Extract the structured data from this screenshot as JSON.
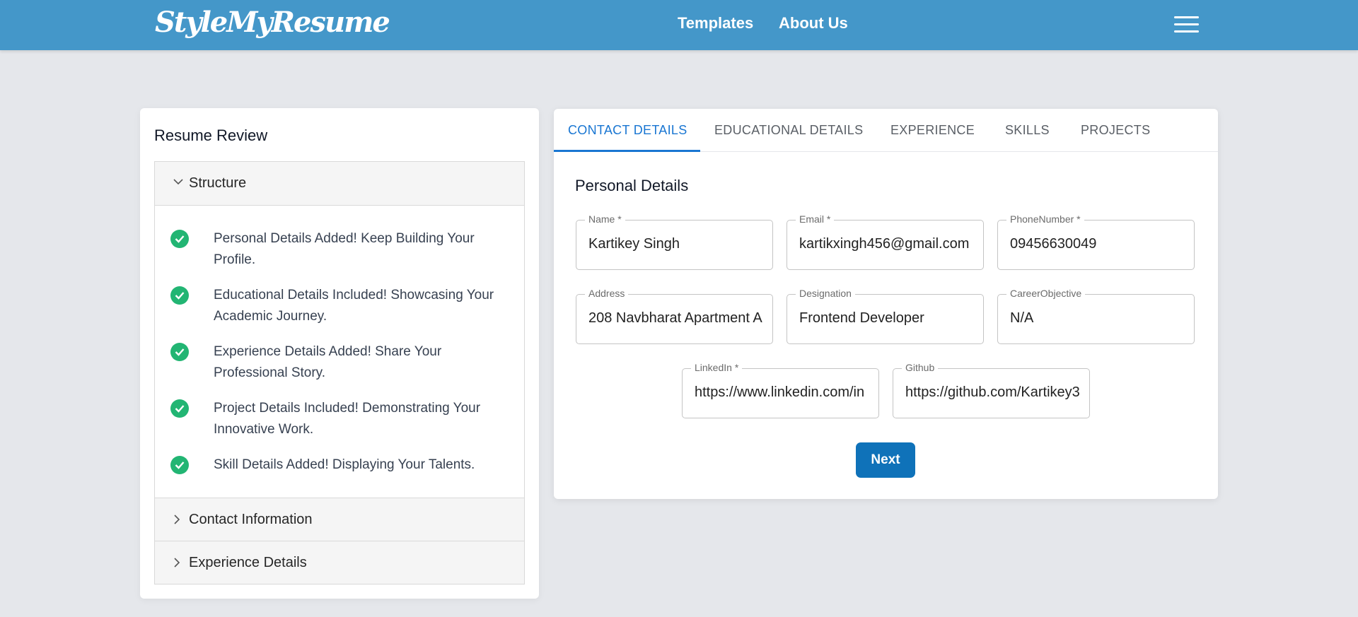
{
  "header": {
    "logo": "StyleMyResume",
    "nav": [
      "Templates",
      "About Us"
    ],
    "menu_icon": "hamburger-menu-icon"
  },
  "review": {
    "title": "Resume Review",
    "sections": [
      {
        "label": "Structure",
        "expanded": true,
        "items": [
          "Personal Details Added! Keep Building Your Profile.",
          "Educational Details Included! Showcasing Your Academic Journey.",
          "Experience Details Added! Share Your Professional Story.",
          "Project Details Included! Demonstrating Your Innovative Work.",
          "Skill Details Added! Displaying Your Talents."
        ]
      },
      {
        "label": "Contact Information",
        "expanded": false
      },
      {
        "label": "Experience Details",
        "expanded": false
      }
    ],
    "check_color": "#22b573"
  },
  "form": {
    "tabs": [
      "CONTACT DETAILS",
      "EDUCATIONAL DETAILS",
      "EXPERIENCE",
      "SKILLS",
      "PROJECTS"
    ],
    "active_tab": "CONTACT DETAILS",
    "section_title": "Personal Details",
    "fields": {
      "name": {
        "label": "Name *",
        "value": "Kartikey Singh"
      },
      "email": {
        "label": "Email *",
        "value": "kartikxingh456@gmail.com"
      },
      "phone": {
        "label": "PhoneNumber *",
        "value": "09456630049"
      },
      "address": {
        "label": "Address",
        "value": "208 Navbharat Apartment A"
      },
      "designation": {
        "label": "Designation",
        "value": "Frontend Developer"
      },
      "career": {
        "label": "CareerObjective",
        "value": "N/A"
      },
      "linkedin": {
        "label": "LinkedIn *",
        "value": "https://www.linkedin.com/in"
      },
      "github": {
        "label": "Github",
        "value": "https://github.com/Kartikey3"
      }
    },
    "next_label": "Next",
    "accent": "#1976d2",
    "button_color": "#0f72b9"
  },
  "colors": {
    "header_bg": "#4497c9",
    "page_bg": "#e5e7eb"
  }
}
